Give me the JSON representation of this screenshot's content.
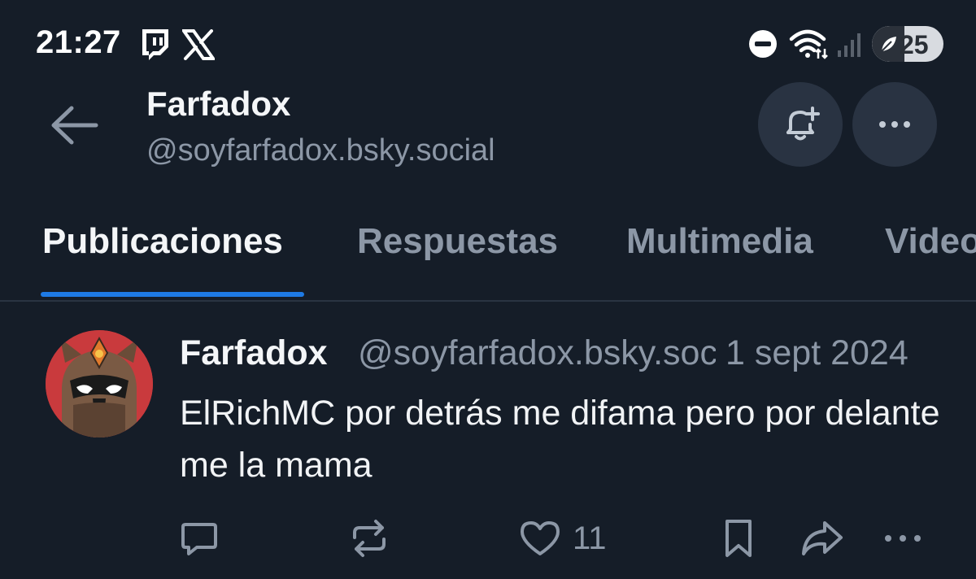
{
  "statusbar": {
    "time": "21:27",
    "left_icons": [
      "twitch-icon",
      "x-logo-icon"
    ],
    "right_icons": [
      "do-not-disturb-icon",
      "wifi-icon",
      "signal-icon",
      "battery-icon"
    ],
    "battery_level": "25"
  },
  "header": {
    "title": "Farfadox",
    "handle": "@soyfarfadox.bsky.social",
    "back_icon": "arrow-left-icon",
    "bell_icon": "bell-plus-icon",
    "more_icon": "more-horizontal-icon"
  },
  "tabs": [
    {
      "label": "Publicaciones",
      "active": true
    },
    {
      "label": "Respuestas",
      "active": false
    },
    {
      "label": "Multimedia",
      "active": false
    },
    {
      "label": "Videos",
      "active": false
    }
  ],
  "post": {
    "author": "Farfadox",
    "handle": "@soyfarfadox.bsky.social",
    "date": "1 sept 2024",
    "text": "ElRichMC por detrás me difama pero por delante me la mama",
    "like_count": "11",
    "action_icons": [
      "reply-icon",
      "repost-icon",
      "heart-icon",
      "bookmark-icon",
      "share-icon",
      "more-horizontal-icon"
    ]
  },
  "colors": {
    "background": "#151d28",
    "accent": "#1e7ae5",
    "muted_text": "#8c97a6",
    "button_bg": "#293342"
  }
}
